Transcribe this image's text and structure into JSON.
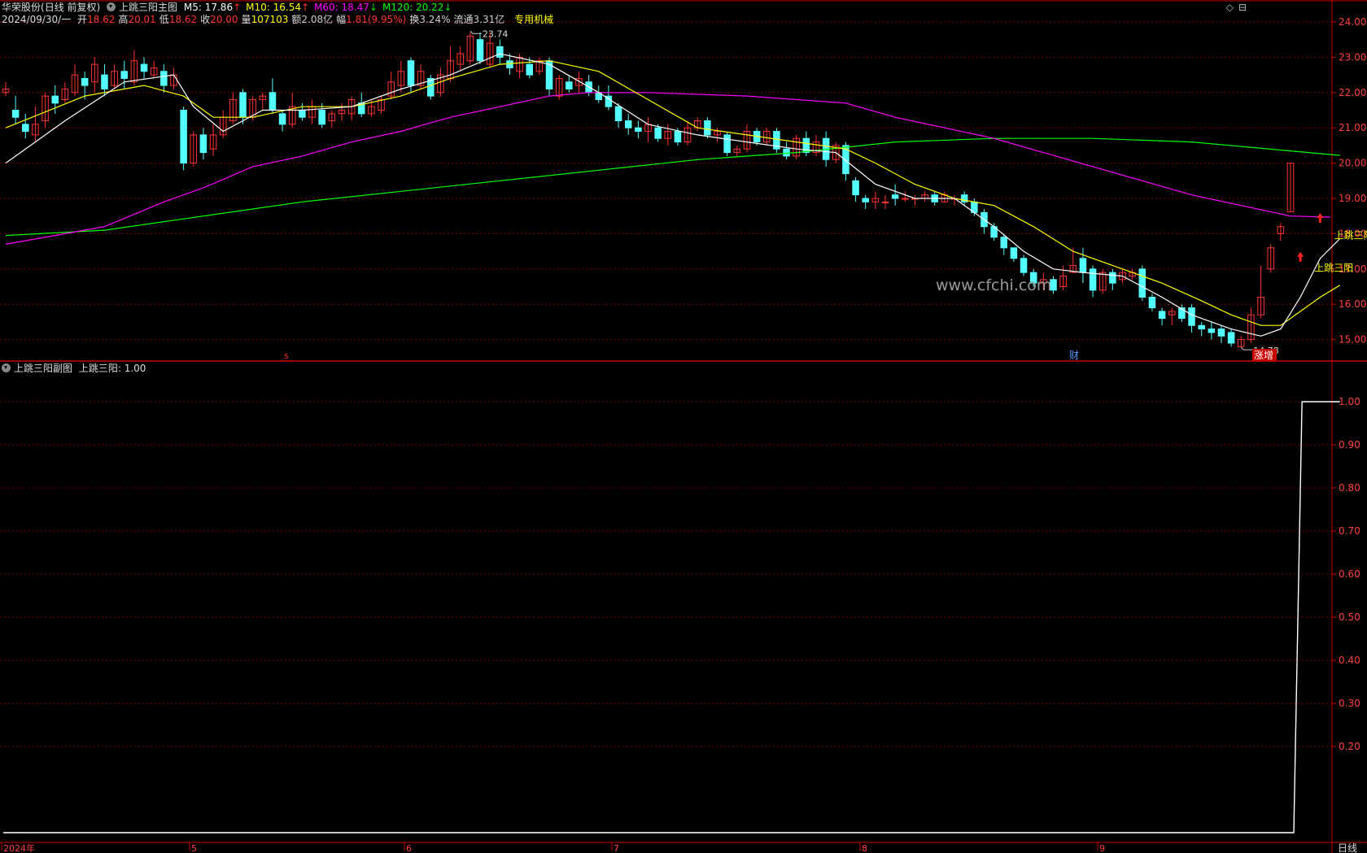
{
  "header": {
    "stock_name": "华荣股份",
    "chart_mode": "(日线 前复权)",
    "main_indicator": "上跳三阳主图",
    "ma": [
      {
        "label": "M5: 17.86",
        "arrow": "↑",
        "color": "#ffffff"
      },
      {
        "label": "M10: 16.54",
        "arrow": "↑",
        "color": "#ffff00"
      },
      {
        "label": "M60: 18.47",
        "arrow": "↓",
        "color": "#ff00ff"
      },
      {
        "label": "M120: 20.22",
        "arrow": "↓",
        "color": "#00ff00"
      }
    ],
    "date": "2024/09/30/一",
    "quote": [
      {
        "label": "开",
        "value": "18.62",
        "color": "#ff3333"
      },
      {
        "label": "高",
        "value": "20.01",
        "color": "#ff3333"
      },
      {
        "label": "低",
        "value": "18.62",
        "color": "#ff3333"
      },
      {
        "label": "收",
        "value": "20.00",
        "color": "#ff3333"
      },
      {
        "label": "量",
        "value": "107103",
        "color": "#ffff00"
      },
      {
        "label": "额",
        "value": "2.08亿",
        "color": "#cccccc"
      },
      {
        "label": "幅",
        "value": "1.81(9.95%)",
        "color": "#ff3333"
      },
      {
        "label": "换",
        "value": "3.24%",
        "color": "#cccccc"
      },
      {
        "label": "流通",
        "value": "3.31亿",
        "color": "#cccccc"
      }
    ],
    "sector": "专用机械",
    "icons": [
      "◇",
      "⊟"
    ]
  },
  "sub_header": {
    "indicator": "上跳三阳副图",
    "value_label": "上跳三阳: 1.00"
  },
  "labels": {
    "signal": "上跳三阳",
    "high_mark": "23.74",
    "low_mark": "14.78",
    "watermark": "www.cfchi.com",
    "event_s": "s",
    "event_cai": "财",
    "event_zhangzeng": "涨增",
    "period": "日线"
  },
  "colors": {
    "up": "#ff3333",
    "down": "#54ffff",
    "ma5": "#ffffff",
    "ma10": "#ffff00",
    "ma60": "#ff00ff",
    "ma120": "#00ff00",
    "axis": "#cc0000",
    "grid": "#7a0000"
  },
  "chart_data": [
    {
      "type": "candlestick",
      "ylim": [
        14.5,
        24.5
      ],
      "y_ticks": [
        "24.00",
        "23.00",
        "22.00",
        "21.00",
        "20.00",
        "19.00",
        "18.00",
        "17.00",
        "16.00",
        "15.00"
      ],
      "x_labels": [
        "2024年",
        "5",
        "6",
        "7",
        "8",
        "9"
      ],
      "candles": [
        [
          22.0,
          22.1,
          22.3,
          21.9
        ],
        [
          21.5,
          21.3,
          21.9,
          21.1
        ],
        [
          21.1,
          20.9,
          21.4,
          20.7
        ],
        [
          20.8,
          21.1,
          21.6,
          20.6
        ],
        [
          21.2,
          21.9,
          22.0,
          21.0
        ],
        [
          21.9,
          21.7,
          22.2,
          21.4
        ],
        [
          21.8,
          22.1,
          22.3,
          21.7
        ],
        [
          22.0,
          22.5,
          22.8,
          21.9
        ],
        [
          22.4,
          22.2,
          22.6,
          21.8
        ],
        [
          22.3,
          22.8,
          23.0,
          22.0
        ],
        [
          22.5,
          22.1,
          22.8,
          21.9
        ],
        [
          22.2,
          22.6,
          22.8,
          22.1
        ],
        [
          22.6,
          22.4,
          22.9,
          22.1
        ],
        [
          22.3,
          22.9,
          23.2,
          22.2
        ],
        [
          22.8,
          22.6,
          23.0,
          22.4
        ],
        [
          22.5,
          22.7,
          22.9,
          22.4
        ],
        [
          22.6,
          22.2,
          22.8,
          22.0
        ],
        [
          22.2,
          22.5,
          22.7,
          22.1
        ],
        [
          21.5,
          20.0,
          21.6,
          19.8
        ],
        [
          20.0,
          20.8,
          20.9,
          19.9
        ],
        [
          20.8,
          20.3,
          21.0,
          20.1
        ],
        [
          20.4,
          20.8,
          21.1,
          20.2
        ],
        [
          20.8,
          21.3,
          21.5,
          20.7
        ],
        [
          21.2,
          21.8,
          22.0,
          21.1
        ],
        [
          22.0,
          21.3,
          22.1,
          21.1
        ],
        [
          21.3,
          21.8,
          21.9,
          21.2
        ],
        [
          21.8,
          21.9,
          22.0,
          21.5
        ],
        [
          22.0,
          21.5,
          22.4,
          21.4
        ],
        [
          21.4,
          21.1,
          21.5,
          20.9
        ],
        [
          21.1,
          21.6,
          22.0,
          21.0
        ],
        [
          21.5,
          21.3,
          21.7,
          21.2
        ],
        [
          21.3,
          21.6,
          21.8,
          21.1
        ],
        [
          21.5,
          21.1,
          21.7,
          21.0
        ],
        [
          21.2,
          21.4,
          21.5,
          21.0
        ],
        [
          21.4,
          21.5,
          21.7,
          21.2
        ],
        [
          21.4,
          21.8,
          21.9,
          21.2
        ],
        [
          21.7,
          21.4,
          22.0,
          21.3
        ],
        [
          21.4,
          21.6,
          21.8,
          21.3
        ],
        [
          21.5,
          21.8,
          21.9,
          21.4
        ],
        [
          21.9,
          22.3,
          22.6,
          21.8
        ],
        [
          22.2,
          22.6,
          22.9,
          22.0
        ],
        [
          22.9,
          22.2,
          23.0,
          22.0
        ],
        [
          22.2,
          22.6,
          22.8,
          22.1
        ],
        [
          22.4,
          21.9,
          22.5,
          21.8
        ],
        [
          22.0,
          22.5,
          22.7,
          21.9
        ],
        [
          22.4,
          22.9,
          23.3,
          22.3
        ],
        [
          22.8,
          23.1,
          23.3,
          22.6
        ],
        [
          22.9,
          23.6,
          23.7,
          22.8
        ],
        [
          23.5,
          22.9,
          23.7,
          22.8
        ],
        [
          22.8,
          23.4,
          23.7,
          22.7
        ],
        [
          23.3,
          23.0,
          23.5,
          22.8
        ],
        [
          22.9,
          22.7,
          23.1,
          22.5
        ],
        [
          22.6,
          23.0,
          23.1,
          22.4
        ],
        [
          22.8,
          22.5,
          23.0,
          22.4
        ],
        [
          22.6,
          22.9,
          23.0,
          22.5
        ],
        [
          22.9,
          22.1,
          23.0,
          21.9
        ],
        [
          21.9,
          22.4,
          22.5,
          21.8
        ],
        [
          22.3,
          22.1,
          22.5,
          22.0
        ],
        [
          22.2,
          22.4,
          22.6,
          22.0
        ],
        [
          22.3,
          22.0,
          22.5,
          21.9
        ],
        [
          22.0,
          21.8,
          22.2,
          21.7
        ],
        [
          21.9,
          21.6,
          22.2,
          21.5
        ],
        [
          21.6,
          21.2,
          21.7,
          21.0
        ],
        [
          21.2,
          21.0,
          21.4,
          20.8
        ],
        [
          21.0,
          20.9,
          21.2,
          20.7
        ],
        [
          20.9,
          21.1,
          21.3,
          20.6
        ],
        [
          21.0,
          20.7,
          21.1,
          20.6
        ],
        [
          20.7,
          20.9,
          21.1,
          20.5
        ],
        [
          20.9,
          20.6,
          21.0,
          20.5
        ],
        [
          20.6,
          21.0,
          21.2,
          20.5
        ],
        [
          21.0,
          21.2,
          21.3,
          20.9
        ],
        [
          21.2,
          20.8,
          21.3,
          20.7
        ],
        [
          20.8,
          20.9,
          21.0,
          20.6
        ],
        [
          20.8,
          20.3,
          20.9,
          20.2
        ],
        [
          20.3,
          20.4,
          20.5,
          20.2
        ],
        [
          20.4,
          20.9,
          21.1,
          20.3
        ],
        [
          20.9,
          20.6,
          21.0,
          20.5
        ],
        [
          20.6,
          20.9,
          21.0,
          20.5
        ],
        [
          20.9,
          20.4,
          21.0,
          20.3
        ],
        [
          20.4,
          20.2,
          20.6,
          20.1
        ],
        [
          20.2,
          20.7,
          20.8,
          20.1
        ],
        [
          20.7,
          20.3,
          20.9,
          20.2
        ],
        [
          20.3,
          20.6,
          20.8,
          20.2
        ],
        [
          20.7,
          20.1,
          20.9,
          19.9
        ],
        [
          20.1,
          20.5,
          20.6,
          20.0
        ],
        [
          20.5,
          19.7,
          20.6,
          19.5
        ],
        [
          19.5,
          19.1,
          19.6,
          18.9
        ],
        [
          19.0,
          18.9,
          19.1,
          18.7
        ],
        [
          18.9,
          19.0,
          19.2,
          18.7
        ],
        [
          18.9,
          18.9,
          19.1,
          18.7
        ],
        [
          19.1,
          19.0,
          19.4,
          18.8
        ],
        [
          19.0,
          19.0,
          19.2,
          18.9
        ],
        [
          19.0,
          19.0,
          19.1,
          18.8
        ],
        [
          19.0,
          19.1,
          19.2,
          18.9
        ],
        [
          19.1,
          18.9,
          19.2,
          18.8
        ],
        [
          18.9,
          19.1,
          19.2,
          18.9
        ],
        [
          19.0,
          19.0,
          19.1,
          18.8
        ],
        [
          19.1,
          18.9,
          19.2,
          18.8
        ],
        [
          18.9,
          18.6,
          19.0,
          18.5
        ],
        [
          18.6,
          18.2,
          18.7,
          18.0
        ],
        [
          18.2,
          17.9,
          18.3,
          17.8
        ],
        [
          17.9,
          17.6,
          18.0,
          17.4
        ],
        [
          17.6,
          17.3,
          17.6,
          17.2
        ],
        [
          17.3,
          16.9,
          17.4,
          16.8
        ],
        [
          16.9,
          16.6,
          17.0,
          16.5
        ],
        [
          16.6,
          16.7,
          16.9,
          16.4
        ],
        [
          16.7,
          16.4,
          16.8,
          16.3
        ],
        [
          16.5,
          16.8,
          17.1,
          16.4
        ],
        [
          16.9,
          17.1,
          17.6,
          16.9
        ],
        [
          17.3,
          16.9,
          17.6,
          16.6
        ],
        [
          17.0,
          16.4,
          17.1,
          16.2
        ],
        [
          16.4,
          16.9,
          17.0,
          16.3
        ],
        [
          16.9,
          16.6,
          17.0,
          16.4
        ],
        [
          16.7,
          16.9,
          17.0,
          16.6
        ],
        [
          16.8,
          16.9,
          17.0,
          16.7
        ],
        [
          17.0,
          16.2,
          17.1,
          16.1
        ],
        [
          16.2,
          15.9,
          16.3,
          15.8
        ],
        [
          15.8,
          15.6,
          15.9,
          15.4
        ],
        [
          15.7,
          15.8,
          15.9,
          15.4
        ],
        [
          15.9,
          15.6,
          16.0,
          15.5
        ],
        [
          15.9,
          15.4,
          16.0,
          15.2
        ],
        [
          15.4,
          15.3,
          15.5,
          15.1
        ],
        [
          15.3,
          15.2,
          15.5,
          15.0
        ],
        [
          15.3,
          15.1,
          15.4,
          14.9
        ],
        [
          15.2,
          14.9,
          15.3,
          14.8
        ],
        [
          14.8,
          15.0,
          15.1,
          14.78
        ],
        [
          15.0,
          15.7,
          15.9,
          14.9
        ],
        [
          15.7,
          16.2,
          17.1,
          15.6
        ],
        [
          17.0,
          17.6,
          17.7,
          16.9
        ],
        [
          18.0,
          18.2,
          18.3,
          17.8
        ],
        [
          18.62,
          20.0,
          20.01,
          18.62
        ]
      ],
      "ma5_points": [
        [
          0,
          20.0
        ],
        [
          6,
          21.2
        ],
        [
          12,
          22.3
        ],
        [
          17,
          22.5
        ],
        [
          19,
          21.6
        ],
        [
          22,
          20.9
        ],
        [
          26,
          21.5
        ],
        [
          30,
          21.5
        ],
        [
          35,
          21.6
        ],
        [
          40,
          22.1
        ],
        [
          45,
          22.5
        ],
        [
          50,
          23.1
        ],
        [
          55,
          22.8
        ],
        [
          60,
          22.0
        ],
        [
          65,
          21.1
        ],
        [
          70,
          20.8
        ],
        [
          75,
          20.6
        ],
        [
          80,
          20.4
        ],
        [
          84,
          20.3
        ],
        [
          88,
          19.4
        ],
        [
          92,
          19.0
        ],
        [
          96,
          19.0
        ],
        [
          100,
          18.2
        ],
        [
          103,
          17.5
        ],
        [
          106,
          17.0
        ],
        [
          109,
          16.9
        ],
        [
          113,
          16.8
        ],
        [
          117,
          16.2
        ],
        [
          120,
          15.7
        ],
        [
          124,
          15.3
        ],
        [
          127,
          15.1
        ],
        [
          129,
          15.3
        ],
        [
          131,
          16.2
        ],
        [
          133,
          17.3
        ],
        [
          135,
          17.86
        ]
      ],
      "ma10_points": [
        [
          0,
          21.0
        ],
        [
          8,
          21.9
        ],
        [
          14,
          22.2
        ],
        [
          18,
          21.9
        ],
        [
          21,
          21.3
        ],
        [
          25,
          21.3
        ],
        [
          30,
          21.6
        ],
        [
          35,
          21.6
        ],
        [
          40,
          21.9
        ],
        [
          45,
          22.4
        ],
        [
          50,
          22.8
        ],
        [
          55,
          22.9
        ],
        [
          60,
          22.6
        ],
        [
          65,
          21.8
        ],
        [
          70,
          21.0
        ],
        [
          75,
          20.8
        ],
        [
          80,
          20.6
        ],
        [
          85,
          20.4
        ],
        [
          88,
          20.0
        ],
        [
          92,
          19.4
        ],
        [
          96,
          19.0
        ],
        [
          100,
          18.8
        ],
        [
          104,
          18.2
        ],
        [
          108,
          17.5
        ],
        [
          113,
          17.0
        ],
        [
          117,
          16.6
        ],
        [
          121,
          16.1
        ],
        [
          124,
          15.7
        ],
        [
          127,
          15.4
        ],
        [
          129,
          15.4
        ],
        [
          131,
          15.8
        ],
        [
          133,
          16.2
        ],
        [
          135,
          16.54
        ]
      ],
      "ma60_points": [
        [
          0,
          17.7
        ],
        [
          10,
          18.2
        ],
        [
          16,
          18.9
        ],
        [
          20,
          19.3
        ],
        [
          25,
          19.9
        ],
        [
          30,
          20.2
        ],
        [
          35,
          20.6
        ],
        [
          40,
          20.9
        ],
        [
          45,
          21.3
        ],
        [
          50,
          21.6
        ],
        [
          55,
          21.9
        ],
        [
          59,
          22.0
        ],
        [
          65,
          22.0
        ],
        [
          75,
          21.9
        ],
        [
          85,
          21.7
        ],
        [
          90,
          21.3
        ],
        [
          95,
          21.0
        ],
        [
          100,
          20.7
        ],
        [
          105,
          20.3
        ],
        [
          110,
          19.9
        ],
        [
          115,
          19.5
        ],
        [
          120,
          19.1
        ],
        [
          125,
          18.8
        ],
        [
          130,
          18.5
        ],
        [
          134,
          18.47
        ]
      ],
      "ma120_points": [
        [
          0,
          17.95
        ],
        [
          10,
          18.1
        ],
        [
          20,
          18.5
        ],
        [
          30,
          18.9
        ],
        [
          40,
          19.2
        ],
        [
          50,
          19.5
        ],
        [
          60,
          19.8
        ],
        [
          70,
          20.1
        ],
        [
          80,
          20.3
        ],
        [
          90,
          20.6
        ],
        [
          100,
          20.7
        ],
        [
          110,
          20.7
        ],
        [
          120,
          20.6
        ],
        [
          135,
          20.22
        ]
      ],
      "markers": [
        {
          "type": "up-arrow",
          "index": 133,
          "value": 18.4
        },
        {
          "type": "up-arrow",
          "index": 131,
          "value": 17.3
        }
      ]
    },
    {
      "type": "line",
      "series": [
        {
          "name": "上跳三阳",
          "x": [
            0,
            130,
            131,
            132
          ],
          "values": [
            0,
            0,
            1,
            1
          ]
        }
      ],
      "ylim": [
        0,
        1.05
      ],
      "y_ticks": [
        "1.00",
        "0.90",
        "0.80",
        "0.70",
        "0.60",
        "0.50",
        "0.40",
        "0.30",
        "0.20"
      ]
    }
  ]
}
